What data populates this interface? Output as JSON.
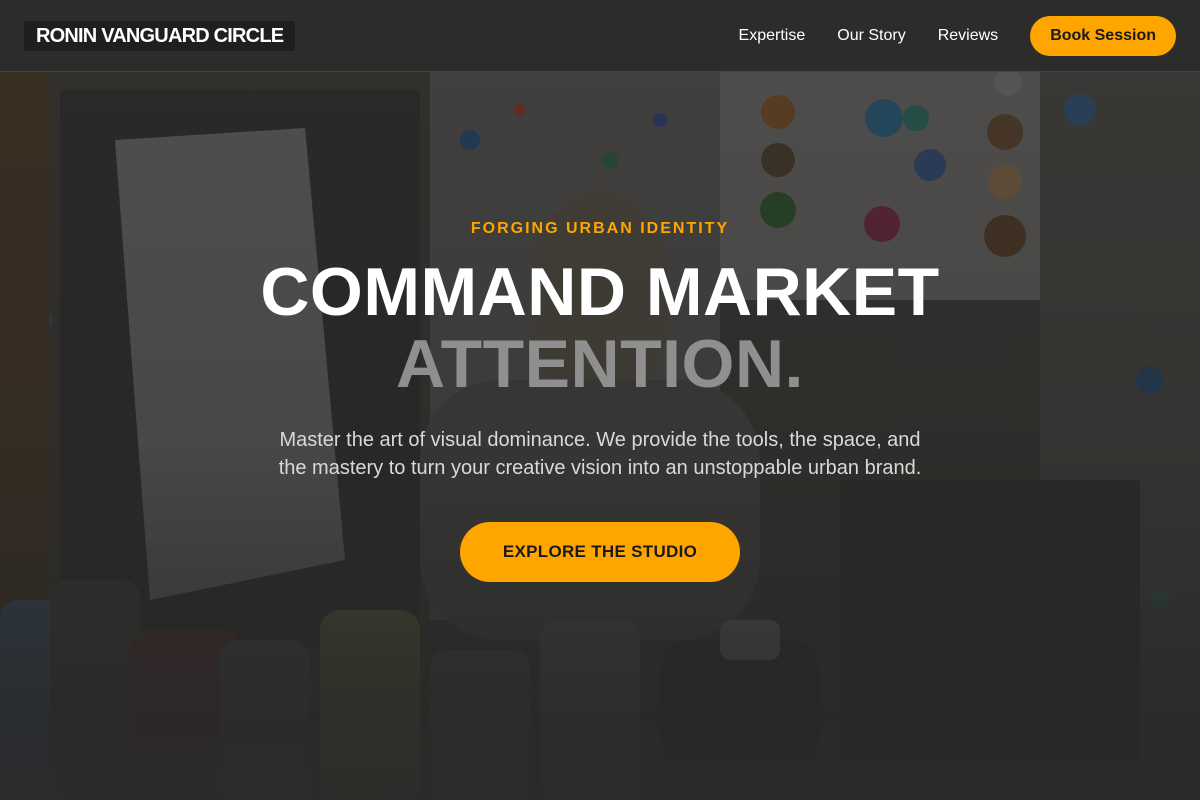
{
  "header": {
    "logo": "RONIN VANGUARD CIRCLE",
    "nav": [
      {
        "label": "Expertise"
      },
      {
        "label": "Our Story"
      },
      {
        "label": "Reviews"
      }
    ],
    "cta_label": "Book Session"
  },
  "hero": {
    "eyebrow": "FORGING URBAN IDENTITY",
    "headline_line1": "COMMAND MARKET",
    "headline_line2": "ATTENTION.",
    "subtext": "Master the art of visual dominance. We provide the tools, the space, and the mastery to turn your creative vision into an unstoppable urban brand.",
    "button_label": "EXPLORE THE STUDIO",
    "background_image": "paint-splattered art studio with canvases and paint bottles"
  },
  "colors": {
    "accent": "#ffa500",
    "header_bg": "#2c2c2c",
    "headline_primary": "#ffffff",
    "headline_secondary": "#8f8f8f",
    "body_text": "#d9d9d9"
  }
}
